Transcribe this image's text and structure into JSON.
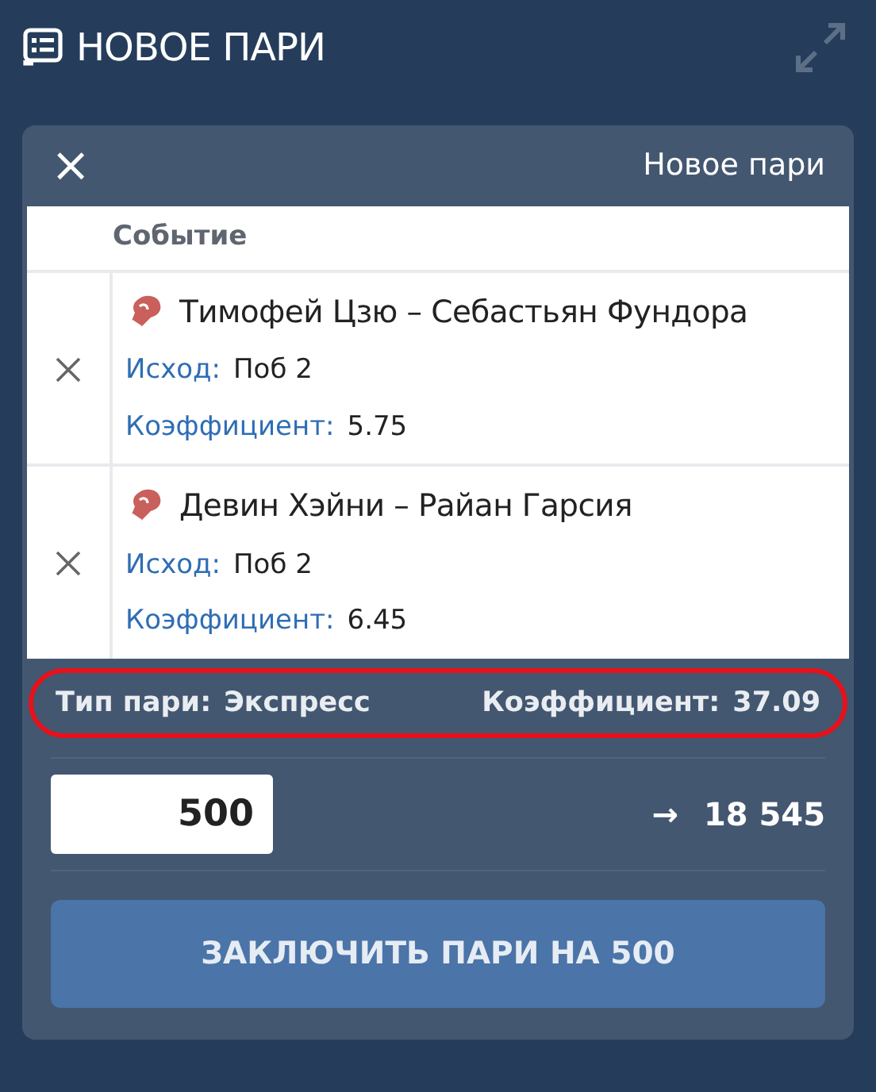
{
  "panel": {
    "title": "НОВОЕ ПАРИ"
  },
  "slip": {
    "close": "×",
    "title": "Новое пари",
    "column": "Событие",
    "events": [
      {
        "name": "Тимофей Цзю – Себастьян Фундора",
        "outcome_label": "Исход:",
        "outcome": "Поб 2",
        "odds_label": "Коэффициент:",
        "odds": "5.75"
      },
      {
        "name": "Девин Хэйни – Райан Гарсия",
        "outcome_label": "Исход:",
        "outcome": "Поб 2",
        "odds_label": "Коэффициент:",
        "odds": "6.45"
      }
    ],
    "summary": {
      "type_label": "Тип пари:",
      "type": "Экспресс",
      "odds_label": "Коэффициент:",
      "odds": "37.09",
      "highlighted": true
    },
    "stake": "500",
    "arrow": "→",
    "payout": "18 545",
    "submit": "ЗАКЛЮЧИТЬ ПАРИ НА 500"
  }
}
